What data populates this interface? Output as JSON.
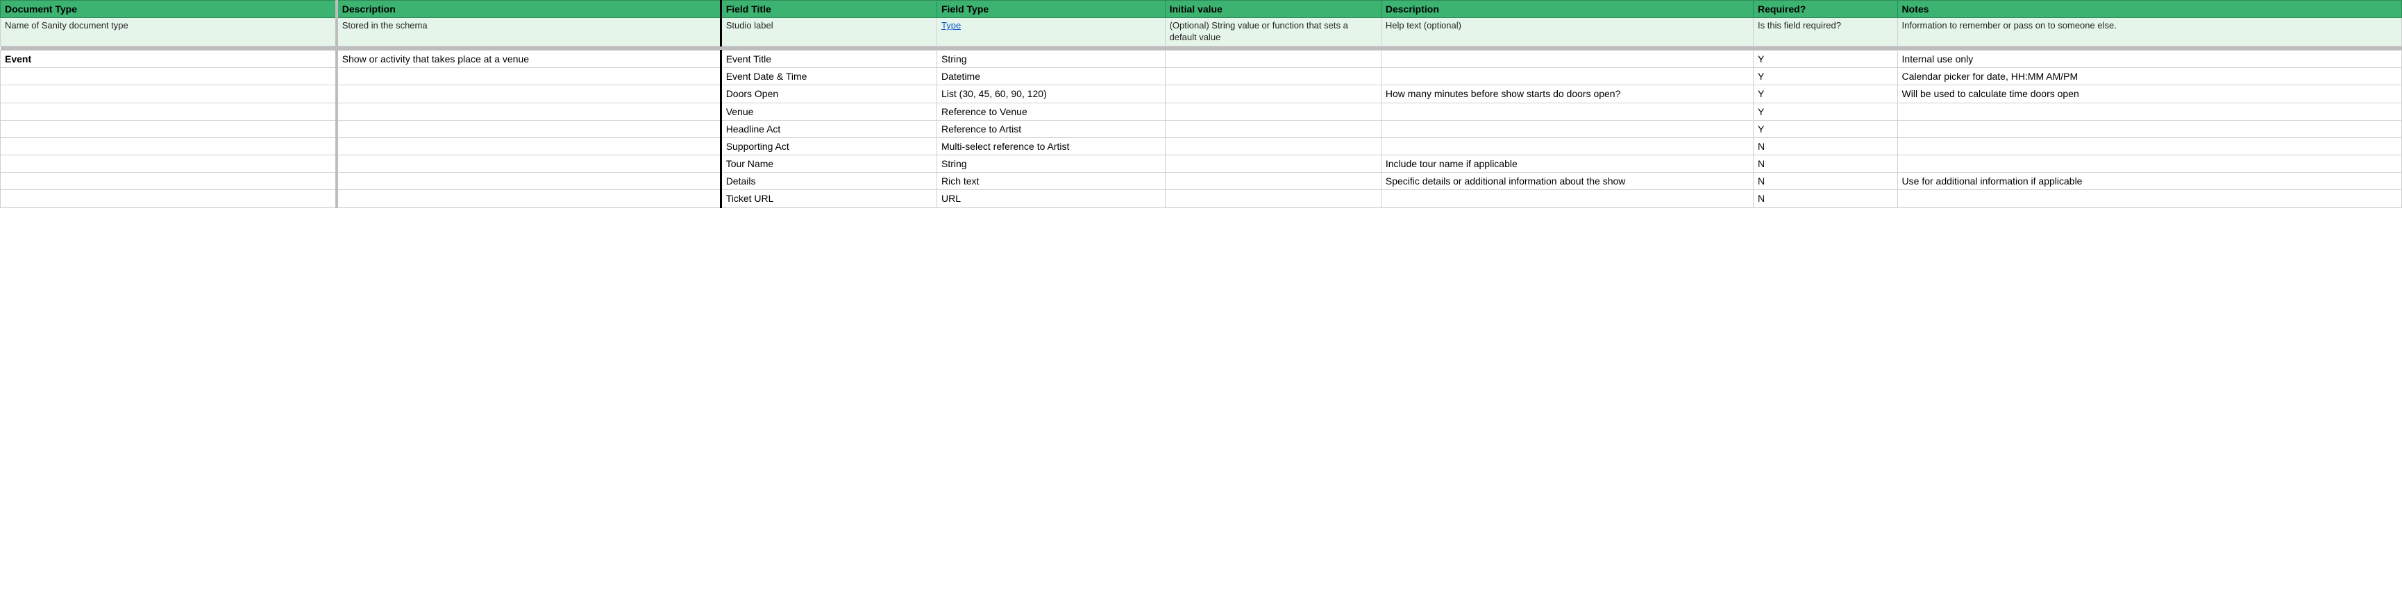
{
  "headers": {
    "doc_type": "Document Type",
    "desc1": "Description",
    "field_title": "Field Title",
    "field_type": "Field Type",
    "initial": "Initial value",
    "desc2": "Description",
    "required": "Required?",
    "notes": "Notes"
  },
  "subheads": {
    "doc_type": "Name of Sanity document type",
    "desc1": "Stored in the schema",
    "field_title": "Studio label",
    "field_type_link": "Type",
    "initial": "(Optional) String value or function that sets a default value",
    "desc2": "Help text (optional)",
    "required": "Is this field required?",
    "notes": "Information to remember or pass on to someone else."
  },
  "doc": {
    "name": "Event",
    "description": "Show or activity that takes place at a venue"
  },
  "rows": [
    {
      "title": "Event Title",
      "ftype": "String",
      "initial": "",
      "desc": "",
      "required": "Y",
      "notes": "Internal use only"
    },
    {
      "title": "Event Date & Time",
      "ftype": "Datetime",
      "initial": "",
      "desc": "",
      "required": "Y",
      "notes": "Calendar picker for date, HH:MM AM/PM"
    },
    {
      "title": "Doors Open",
      "ftype": "List (30, 45, 60, 90, 120)",
      "initial": "",
      "desc": "How many minutes before show starts do doors open?",
      "required": "Y",
      "notes": "Will be used to calculate time doors open"
    },
    {
      "title": "Venue",
      "ftype": "Reference to Venue",
      "initial": "",
      "desc": "",
      "required": "Y",
      "notes": ""
    },
    {
      "title": "Headline Act",
      "ftype": "Reference to Artist",
      "initial": "",
      "desc": "",
      "required": "Y",
      "notes": ""
    },
    {
      "title": "Supporting Act",
      "ftype": "Multi-select reference to Artist",
      "initial": "",
      "desc": "",
      "required": "N",
      "notes": ""
    },
    {
      "title": "Tour Name",
      "ftype": "String",
      "initial": "",
      "desc": "Include tour name if applicable",
      "required": "N",
      "notes": ""
    },
    {
      "title": "Details",
      "ftype": "Rich text",
      "initial": "",
      "desc": "Specific details or additional information about the show",
      "required": "N",
      "notes": "Use for additional information if applicable"
    },
    {
      "title": "Ticket URL",
      "ftype": "URL",
      "initial": "",
      "desc": "",
      "required": "N",
      "notes": ""
    }
  ]
}
